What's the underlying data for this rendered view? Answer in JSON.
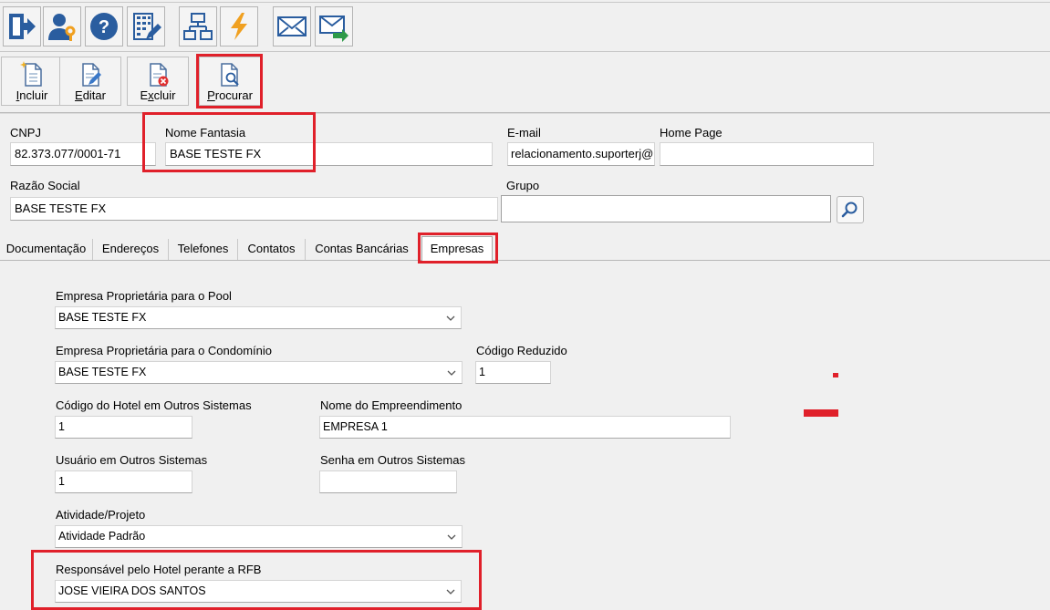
{
  "toolbar_icons": [
    {
      "name": "exit-icon"
    },
    {
      "name": "user-key-icon"
    },
    {
      "name": "help-icon"
    },
    {
      "name": "building-edit-icon"
    },
    {
      "name": "org-chart-icon"
    },
    {
      "name": "lightning-icon"
    },
    {
      "name": "mail-icon"
    },
    {
      "name": "mail-forward-icon"
    }
  ],
  "commands": {
    "incluir": {
      "first": "I",
      "rest": "ncluir"
    },
    "editar": {
      "first": "E",
      "rest": "ditar"
    },
    "excluir_pre": "E",
    "excluir_u": "x",
    "excluir_post": "cluir",
    "procurar": {
      "first": "P",
      "rest": "rocurar"
    }
  },
  "header": {
    "cnpj_label": "CNPJ",
    "cnpj_value": "82.373.077/0001-71",
    "nome_fantasia_label": "Nome Fantasia",
    "nome_fantasia_value": "BASE TESTE FX",
    "email_label": "E-mail",
    "email_value": "relacionamento.suporterj@",
    "homepage_label": "Home Page",
    "homepage_value": "",
    "razao_social_label": "Razão Social",
    "razao_social_value": "BASE TESTE FX",
    "grupo_label": "Grupo",
    "grupo_value": ""
  },
  "tabs": [
    "Documentação",
    "Endereços",
    "Telefones",
    "Contatos",
    "Contas Bancárias",
    "Empresas"
  ],
  "active_tab": "Empresas",
  "empresas": {
    "pool_label": "Empresa Proprietária para o Pool",
    "pool_value": "BASE TESTE FX",
    "condominio_label": "Empresa Proprietária para o Condomínio",
    "condominio_value": "BASE TESTE FX",
    "codigo_reduzido_label": "Código Reduzido",
    "codigo_reduzido_value": "1",
    "codigo_hotel_label": "Código do Hotel em Outros Sistemas",
    "codigo_hotel_value": "1",
    "nome_empreendimento_label": "Nome do Empreendimento",
    "nome_empreendimento_value": "EMPRESA 1",
    "usuario_label": "Usuário em Outros Sistemas",
    "usuario_value": "1",
    "senha_label": "Senha em Outros Sistemas",
    "senha_value": "",
    "atividade_label": "Atividade/Projeto",
    "atividade_value": "Atividade Padrão",
    "responsavel_label": "Responsável pelo Hotel perante a RFB",
    "responsavel_value": "JOSE VIEIRA DOS SANTOS"
  },
  "colors": {
    "highlight": "#e0202a",
    "icon_blue": "#2a5d9f",
    "accent_orange": "#f0a020"
  }
}
